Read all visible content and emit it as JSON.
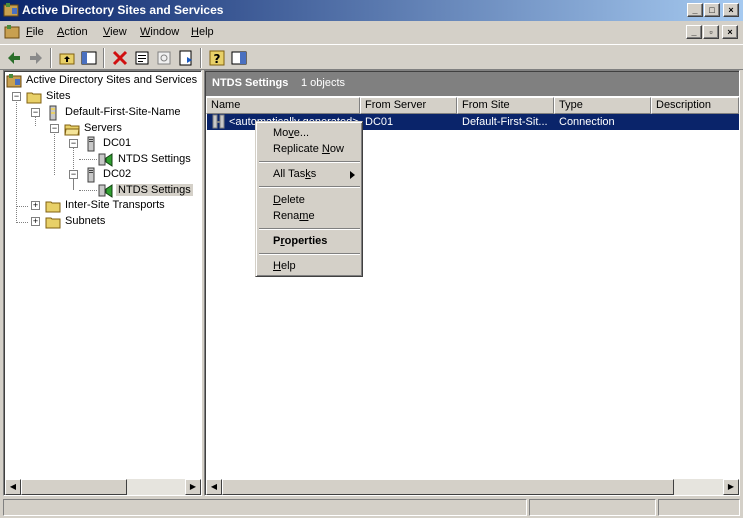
{
  "window": {
    "title": "Active Directory Sites and Services",
    "minimize": "_",
    "maximize": "□",
    "close": "×"
  },
  "menubar": {
    "items": [
      {
        "prefix": "",
        "u": "F",
        "rest": "ile"
      },
      {
        "prefix": "",
        "u": "A",
        "rest": "ction"
      },
      {
        "prefix": "",
        "u": "V",
        "rest": "iew"
      },
      {
        "prefix": "",
        "u": "W",
        "rest": "indow"
      },
      {
        "prefix": "",
        "u": "H",
        "rest": "elp"
      }
    ],
    "mdi_minimize": "_",
    "mdi_restore": "▫",
    "mdi_close": "×"
  },
  "tree": {
    "root": "Active Directory Sites and Services [D",
    "sites": "Sites",
    "default_site": "Default-First-Site-Name",
    "servers": "Servers",
    "dc01": "DC01",
    "dc01_ntds": "NTDS Settings",
    "dc02": "DC02",
    "dc02_ntds": "NTDS Settings",
    "inter_site": "Inter-Site Transports",
    "subnets": "Subnets"
  },
  "result": {
    "title": "NTDS Settings",
    "count": "1 objects",
    "columns": [
      "Name",
      "From Server",
      "From Site",
      "Type",
      "Description"
    ],
    "rows": [
      {
        "name": "<automatically generated>",
        "from_server": "DC01",
        "from_site": "Default-First-Sit...",
        "type": "Connection",
        "description": ""
      }
    ]
  },
  "context_menu": {
    "move": {
      "a": "Mo",
      "u": "v",
      "b": "e..."
    },
    "replicate": {
      "a": "Replicate ",
      "u": "N",
      "b": "ow"
    },
    "all_tasks": {
      "a": "All Tas",
      "u": "k",
      "b": "s"
    },
    "delete": {
      "a": "",
      "u": "D",
      "b": "elete"
    },
    "rename": {
      "a": "Rena",
      "u": "m",
      "b": "e"
    },
    "properties": {
      "a": "P",
      "u": "r",
      "b": "operties"
    },
    "help": {
      "a": "",
      "u": "H",
      "b": "elp"
    }
  },
  "colors": {
    "titlebar_start": "#0a246a",
    "titlebar_end": "#a6caf0",
    "selection": "#0a246a",
    "face": "#d4d0c8"
  }
}
